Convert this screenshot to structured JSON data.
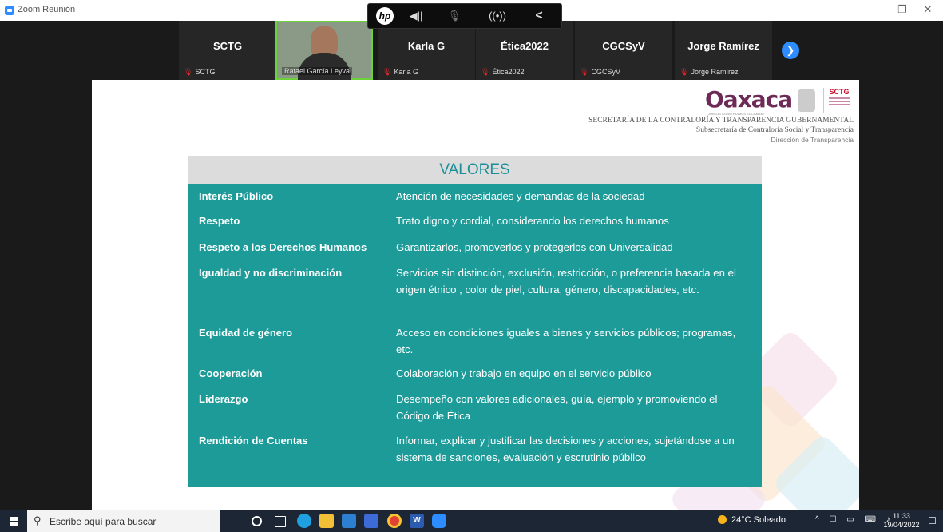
{
  "window": {
    "title": "Zoom Reunión",
    "minimize": "—",
    "maximize": "❐",
    "close": "✕"
  },
  "floatbar": {
    "hp": "hp",
    "speaker": "◀||",
    "mic": "🎙",
    "broadcast": "((•))",
    "collapse": "<"
  },
  "participants": [
    {
      "name": "SCTG",
      "label": "SCTG",
      "video": false
    },
    {
      "name": "",
      "label": "Rafael García Leyva",
      "video": true
    },
    {
      "name": "Karla G",
      "label": "Karla G",
      "video": false
    },
    {
      "name": "Ética2022",
      "label": "Ética2022",
      "video": false
    },
    {
      "name": "CGCSyV",
      "label": "CGCSyV",
      "video": false
    },
    {
      "name": "Jorge Ramírez",
      "label": "Jorge Ramírez",
      "video": false
    }
  ],
  "next_icon": "❯",
  "slide": {
    "logo_text": "Oaxaca",
    "logo_tagline": "JUNTOS CONSTRUIMOS EL CAMBIO",
    "sctg_label": "SCTG",
    "header_line1": "SECRETARÍA DE LA CONTRALORÍA Y TRANSPARENCIA GUBERNAMENTAL",
    "header_line2": "Subsecretaría de Contraloría Social y Transparencia",
    "header_line3": "Dirección de Transparencia",
    "table_title": "VALORES",
    "rows": [
      {
        "term": "Interés Público",
        "def": "Atención de necesidades y demandas de la sociedad"
      },
      {
        "term": "Respeto",
        "def": "Trato digno y cordial, considerando los derechos humanos"
      },
      {
        "term": "Respeto a los Derechos Humanos",
        "def": "Garantizarlos, promoverlos y protegerlos con Universalidad"
      },
      {
        "term": "Igualdad y no discriminación",
        "def": "Servicios sin distinción, exclusión, restricción, o preferencia basada en el origen étnico , color de piel, cultura, género, discapacidades, etc."
      },
      {
        "term": "Equidad de género",
        "def": "Acceso en condiciones iguales a bienes y servicios públicos; programas, etc."
      },
      {
        "term": "Cooperación",
        "def": "Colaboración y trabajo en equipo en el servicio público"
      },
      {
        "term": "Liderazgo",
        "def": "Desempeño con valores adicionales, guía, ejemplo y promoviendo el Código de Ética"
      },
      {
        "term": "Rendición de Cuentas",
        "def": "Informar, explicar y justificar las decisiones y acciones, sujetándose a un sistema de sanciones, evaluación y escrutinio público"
      }
    ]
  },
  "taskbar": {
    "search_placeholder": "Escribe aquí para buscar",
    "weather": "24°C Soleado",
    "time": "11:33",
    "date": "19/04/2022",
    "tray_icons": "^ ☐ ▭ ⌨ ♪"
  },
  "colors": {
    "teal": "#1d9b99",
    "header_gray": "#dcdcdc",
    "title_teal": "#1d8f9a",
    "taskbar": "#1d2635"
  }
}
